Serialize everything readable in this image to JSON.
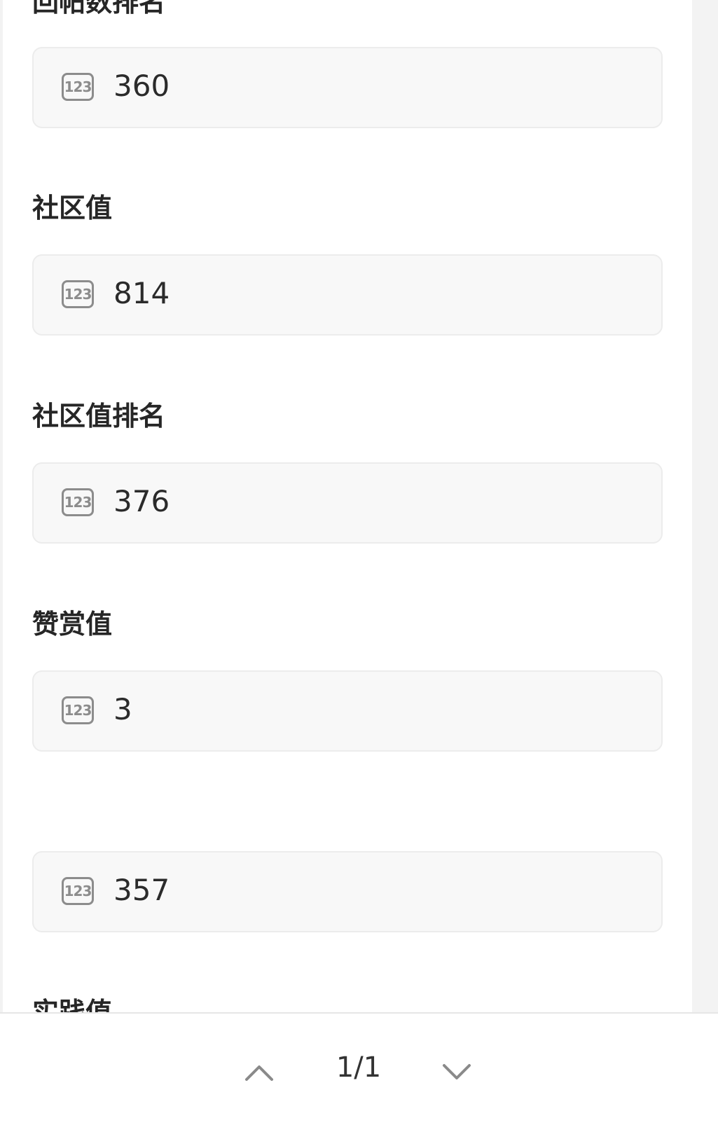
{
  "fields": [
    {
      "label": "回帖数排名",
      "value": "360",
      "icon": "number-icon",
      "icon_text": "123"
    },
    {
      "label": "社区值",
      "value": "814",
      "icon": "number-icon",
      "icon_text": "123"
    },
    {
      "label": "社区值排名",
      "value": "376",
      "icon": "number-icon",
      "icon_text": "123"
    },
    {
      "label": "赞赏值",
      "value": "3",
      "icon": "number-icon",
      "icon_text": "123"
    },
    {
      "label": "",
      "value": "357",
      "icon": "number-icon",
      "icon_text": "123"
    },
    {
      "label": "实践值",
      "value": "",
      "icon": "number-icon",
      "icon_text": "123"
    }
  ],
  "pager": {
    "indicator": "1/1",
    "prev_icon": "chevron-up-icon",
    "next_icon": "chevron-down-icon"
  },
  "colors": {
    "label_text": "#262626",
    "value_text": "#2b2b2b",
    "box_background": "#f8f8f8",
    "box_border": "#ececec",
    "icon": "#8c8c8c",
    "side_panel": "#f3f3f3"
  }
}
